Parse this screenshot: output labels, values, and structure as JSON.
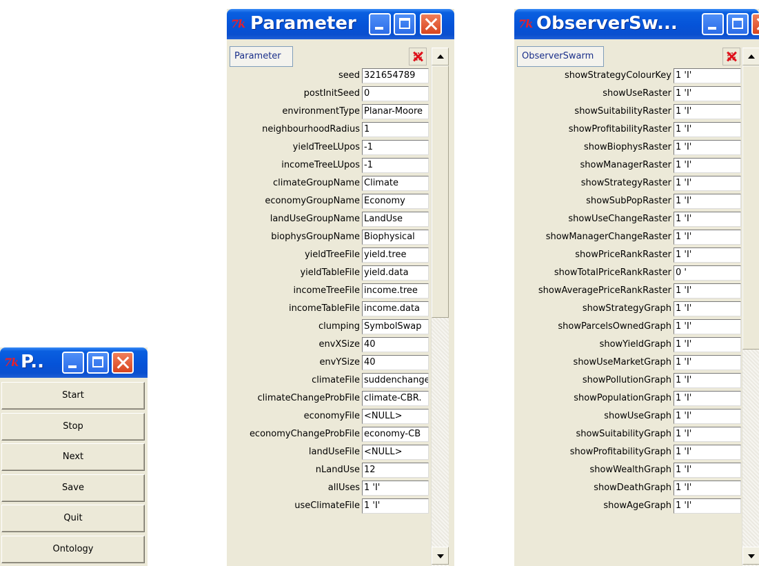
{
  "control_panel": {
    "title": "P..",
    "tk_logo": "7k",
    "buttons": [
      "Start",
      "Stop",
      "Next",
      "Save",
      "Quit",
      "Ontology"
    ]
  },
  "parameter_window": {
    "title": "Parameter",
    "tk_logo": "7k",
    "header_button": "Parameter",
    "fields": [
      {
        "label": "seed",
        "value": "321654789"
      },
      {
        "label": "postInitSeed",
        "value": "0"
      },
      {
        "label": "environmentType",
        "value": "Planar-Moore"
      },
      {
        "label": "neighbourhoodRadius",
        "value": "1"
      },
      {
        "label": "yieldTreeLUpos",
        "value": "-1"
      },
      {
        "label": "incomeTreeLUpos",
        "value": "-1"
      },
      {
        "label": "climateGroupName",
        "value": "Climate"
      },
      {
        "label": "economyGroupName",
        "value": "Economy"
      },
      {
        "label": "landUseGroupName",
        "value": "LandUse"
      },
      {
        "label": "biophysGroupName",
        "value": "Biophysical"
      },
      {
        "label": "yieldTreeFile",
        "value": "yield.tree"
      },
      {
        "label": "yieldTableFile",
        "value": "yield.data"
      },
      {
        "label": "incomeTreeFile",
        "value": "income.tree"
      },
      {
        "label": "incomeTableFile",
        "value": "income.data"
      },
      {
        "label": "clumping",
        "value": "SymbolSwap"
      },
      {
        "label": "envXSize",
        "value": "40"
      },
      {
        "label": "envYSize",
        "value": "40"
      },
      {
        "label": "climateFile",
        "value": "suddenchange"
      },
      {
        "label": "climateChangeProbFile",
        "value": "climate-CBR."
      },
      {
        "label": "economyFile",
        "value": "<NULL>"
      },
      {
        "label": "economyChangeProbFile",
        "value": "economy-CB"
      },
      {
        "label": "landUseFile",
        "value": "<NULL>"
      },
      {
        "label": "nLandUse",
        "value": "12"
      },
      {
        "label": "allUses",
        "value": "1 'I'"
      },
      {
        "label": "useClimateFile",
        "value": "1 'I'"
      }
    ]
  },
  "observer_window": {
    "title": "ObserverSw...",
    "tk_logo": "7k",
    "header_button": "ObserverSwarm",
    "fields": [
      {
        "label": "showStrategyColourKey",
        "value": "1 'I'"
      },
      {
        "label": "showUseRaster",
        "value": "1 'I'"
      },
      {
        "label": "showSuitabilityRaster",
        "value": "1 'I'"
      },
      {
        "label": "showProfitabilityRaster",
        "value": "1 'I'"
      },
      {
        "label": "showBiophysRaster",
        "value": "1 'I'"
      },
      {
        "label": "showManagerRaster",
        "value": "1 'I'"
      },
      {
        "label": "showStrategyRaster",
        "value": "1 'I'"
      },
      {
        "label": "showSubPopRaster",
        "value": "1 'I'"
      },
      {
        "label": "showUseChangeRaster",
        "value": "1 'I'"
      },
      {
        "label": "showManagerChangeRaster",
        "value": "1 'I'"
      },
      {
        "label": "showPriceRankRaster",
        "value": "1 'I'"
      },
      {
        "label": "showTotalPriceRankRaster",
        "value": "0 '"
      },
      {
        "label": "showAveragePriceRankRaster",
        "value": "1 'I'"
      },
      {
        "label": "showStrategyGraph",
        "value": "1 'I'"
      },
      {
        "label": "showParcelsOwnedGraph",
        "value": "1 'I'"
      },
      {
        "label": "showYieldGraph",
        "value": "1 'I'"
      },
      {
        "label": "showUseMarketGraph",
        "value": "1 'I'"
      },
      {
        "label": "showPollutionGraph",
        "value": "1 'I'"
      },
      {
        "label": "showPopulationGraph",
        "value": "1 'I'"
      },
      {
        "label": "showUseGraph",
        "value": "1 'I'"
      },
      {
        "label": "showSuitabilityGraph",
        "value": "1 'I'"
      },
      {
        "label": "showProfitabilityGraph",
        "value": "1 'I'"
      },
      {
        "label": "showWealthGraph",
        "value": "1 'I'"
      },
      {
        "label": "showDeathGraph",
        "value": "1 'I'"
      },
      {
        "label": "showAgeGraph",
        "value": "1 'I'"
      }
    ]
  },
  "colors": {
    "titlebar": "#0553d8",
    "window_face": "#ece9d8",
    "close_button": "#d8451f",
    "tk_logo": "#e8202a"
  }
}
